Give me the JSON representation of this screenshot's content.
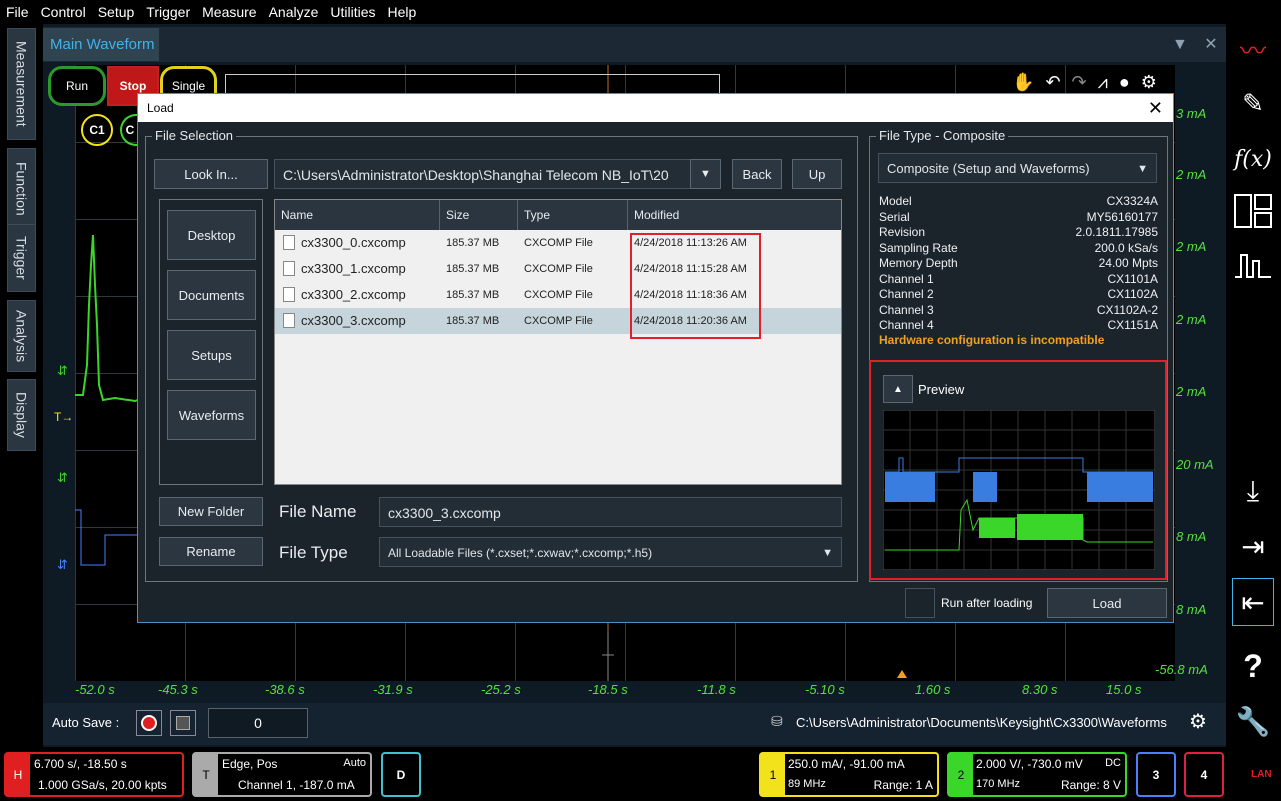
{
  "menu": [
    "File",
    "Control",
    "Setup",
    "Trigger",
    "Measure",
    "Analyze",
    "Utilities",
    "Help"
  ],
  "left_tabs": [
    "Measurement",
    "Function",
    "Trigger",
    "Analysis",
    "Display"
  ],
  "main": {
    "tab_title": "Main Waveform",
    "run_label": "Run",
    "stop_label": "Stop",
    "single_label": "Single",
    "channel_badges": [
      "C1",
      "C"
    ],
    "trigger_marker": "T"
  },
  "x_axis_labels": [
    "-52.0 s",
    "-45.3 s",
    "-38.6 s",
    "-31.9 s",
    "-25.2 s",
    "-18.5 s",
    "-11.8 s",
    "-5.10 s",
    "1.60 s",
    "8.30 s",
    "15.0 s"
  ],
  "y_axis_labels": [
    "3 mA",
    "2 mA",
    "2 mA",
    "2 mA",
    "2 mA",
    "20 mA",
    "8 mA",
    "8 mA",
    "-56.8 mA"
  ],
  "autosave": {
    "label": "Auto Save :",
    "count": "0",
    "path": "C:\\Users\\Administrator\\Documents\\Keysight\\Cx3300\\Waveforms"
  },
  "status": {
    "h_badge": "H",
    "h_line1": "6.700 s/, -18.50 s",
    "h_line2": "1.000 GSa/s, 20.00 kpts",
    "t_badge": "T",
    "t_line1": "Edge, Pos",
    "t_mode": "Auto",
    "t_line2": "Channel 1, -187.0 mA",
    "d_badge": "D",
    "ch1_badge": "1",
    "ch1_line1": "250.0 mA/, -91.00 mA",
    "ch1_bw": "89 MHz",
    "ch1_range": "Range: 1 A",
    "ch2_badge": "2",
    "ch2_line1": "2.000 V/, -730.0 mV",
    "ch2_coupling": "DC",
    "ch2_bw": "170 MHz",
    "ch2_range": "Range: 8 V",
    "ch3_badge": "3",
    "ch4_badge": "4",
    "lan": "LAN"
  },
  "dialog": {
    "title": "Load",
    "file_selection_title": "File Selection",
    "look_in_label": "Look In...",
    "path": "C:\\Users\\Administrator\\Desktop\\Shanghai Telecom NB_IoT\\20",
    "back_label": "Back",
    "up_label": "Up",
    "places": [
      "Desktop",
      "Documents",
      "Setups",
      "Waveforms"
    ],
    "columns": [
      "Name",
      "Size",
      "Type",
      "Modified"
    ],
    "files": [
      {
        "name": "cx3300_0.cxcomp",
        "size": "185.37 MB",
        "type": "CXCOMP File",
        "modified": "4/24/2018 11:13:26 AM"
      },
      {
        "name": "cx3300_1.cxcomp",
        "size": "185.37 MB",
        "type": "CXCOMP File",
        "modified": "4/24/2018 11:15:28 AM"
      },
      {
        "name": "cx3300_2.cxcomp",
        "size": "185.37 MB",
        "type": "CXCOMP File",
        "modified": "4/24/2018 11:18:36 AM"
      },
      {
        "name": "cx3300_3.cxcomp",
        "size": "185.37 MB",
        "type": "CXCOMP File",
        "modified": "4/24/2018 11:20:36 AM"
      }
    ],
    "new_folder_label": "New Folder",
    "rename_label": "Rename",
    "file_name_label": "File Name",
    "file_name_value": "cx3300_3.cxcomp",
    "file_type_label": "File Type",
    "file_type_value": "All Loadable Files (*.cxset;*.cxwav;*.cxcomp;*.h5)",
    "file_type_group_title": "File Type  -  Composite",
    "composite_option": "Composite (Setup and Waveforms)",
    "info": [
      {
        "k": "Model",
        "v": "CX3324A"
      },
      {
        "k": "Serial",
        "v": "MY56160177"
      },
      {
        "k": "Revision",
        "v": "2.0.1811.17985"
      },
      {
        "k": "Sampling Rate",
        "v": "200.0 kSa/s"
      },
      {
        "k": "Memory Depth",
        "v": "24.00 Mpts"
      },
      {
        "k": "Channel 1",
        "v": "CX1101A"
      },
      {
        "k": "Channel 2",
        "v": "CX1102A"
      },
      {
        "k": "Channel 3",
        "v": "CX1102A-2"
      },
      {
        "k": "Channel 4",
        "v": "CX1151A"
      }
    ],
    "warning": "Hardware configuration is incompatible",
    "preview_label": "Preview",
    "run_after_loading_label": "Run after loading",
    "load_label": "Load"
  },
  "colors": {
    "accent_blue": "#3fb4ec",
    "ch1_yellow": "#f2e21c",
    "ch2_green": "#3ad62a",
    "highlight_red": "#e0202a",
    "warning_orange": "#f0a020"
  }
}
